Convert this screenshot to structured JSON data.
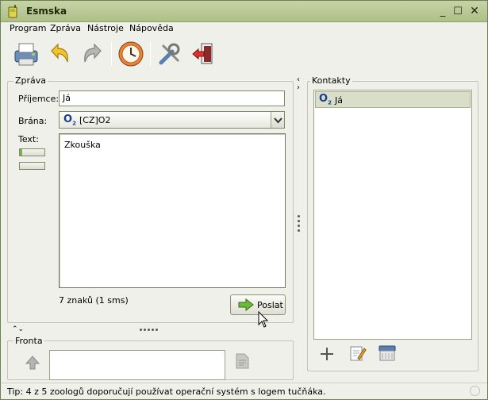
{
  "window": {
    "title": "Esmska"
  },
  "menu": {
    "items": [
      "Program",
      "Zpráva",
      "Nástroje",
      "Nápověda"
    ]
  },
  "toolbar": {
    "icons": [
      "printer-icon",
      "undo-icon",
      "redo-icon",
      "clock-icon",
      "tools-icon",
      "exit-icon"
    ]
  },
  "message": {
    "group_label": "Zpráva",
    "recipient_label": "Příjemce:",
    "recipient_value": "Já",
    "gateway_label": "Brána:",
    "gateway_logo": "O",
    "gateway_logo_sub": "2",
    "gateway_value": "[CZ]O2",
    "text_label": "Text:",
    "text_value": "Zkouška",
    "char_count": "7 znaků (1 sms)",
    "send_label": "Poslat"
  },
  "contacts": {
    "group_label": "Kontakty",
    "items": [
      {
        "logo": "O",
        "logo_sub": "2",
        "name": "Já"
      }
    ]
  },
  "queue": {
    "group_label": "Fronta"
  },
  "status": {
    "tip": "Tip: 4 z 5 zoologů doporučují používat operační systém s logem tučňáka."
  },
  "colors": {
    "accent": "#b8c79a",
    "selection": "#d8dec8",
    "titlebar": "#aebf87"
  }
}
